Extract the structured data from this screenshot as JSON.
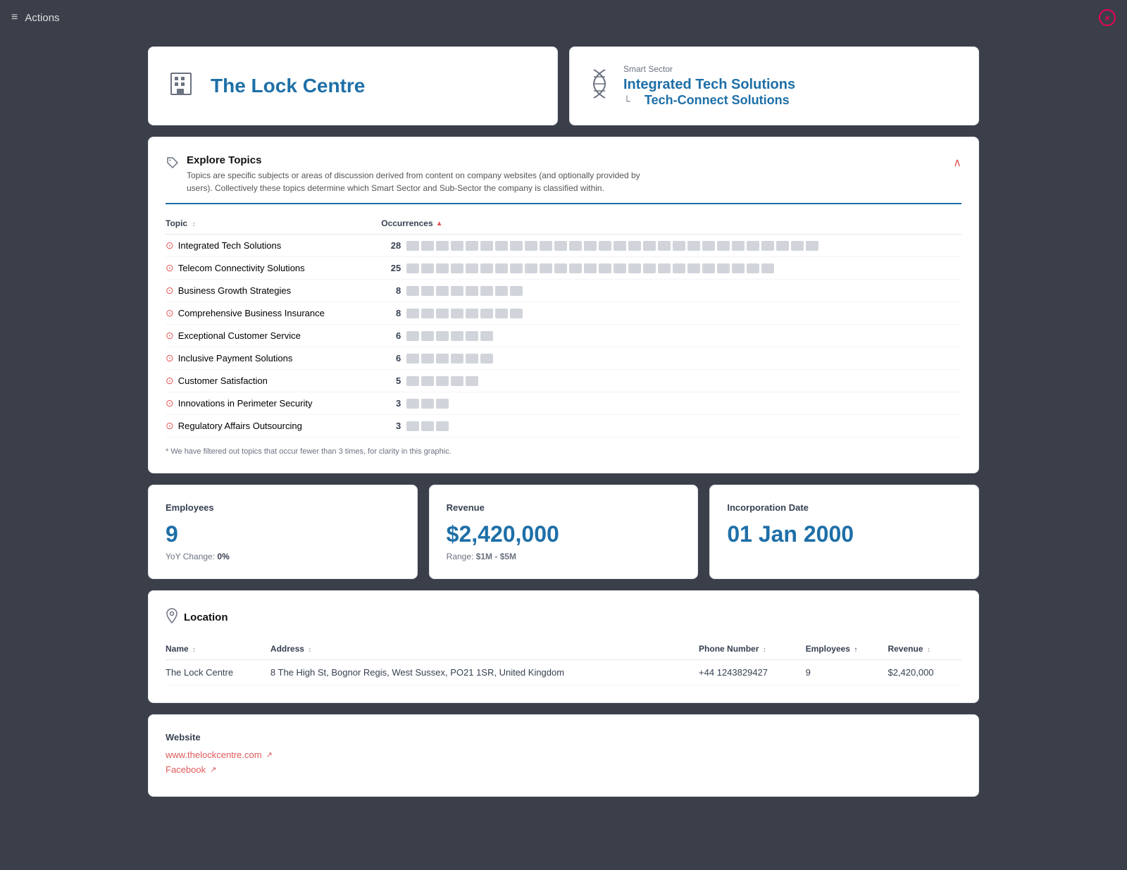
{
  "topBar": {
    "actionsLabel": "Actions",
    "closeBtn": "×"
  },
  "companyCard": {
    "name": "The Lock Centre",
    "buildingIconUnicode": "🏢"
  },
  "sectorCard": {
    "smartSectorLabel": "Smart Sector",
    "primarySector": "Integrated Tech Solutions",
    "secondarySector": "Tech-Connect Solutions",
    "dnaIconUnicode": "⌥"
  },
  "topicsSection": {
    "tagIcon": "🏷",
    "title": "Explore Topics",
    "description": "Topics are specific subjects or areas of discussion derived from content on company websites (and optionally provided by users). Collectively these topics determine which Smart Sector and Sub-Sector the company is classified within.",
    "colTopic": "Topic",
    "colOccurrences": "Occurrences",
    "collapseIcon": "∧",
    "footerNote": "* We have filtered out topics that occur fewer than 3 times, for clarity in this graphic.",
    "topics": [
      {
        "name": "Integrated Tech Solutions",
        "count": 28,
        "bars": 28
      },
      {
        "name": "Telecom Connectivity Solutions",
        "count": 25,
        "bars": 25
      },
      {
        "name": "Business Growth Strategies",
        "count": 8,
        "bars": 8
      },
      {
        "name": "Comprehensive Business Insurance",
        "count": 8,
        "bars": 8
      },
      {
        "name": "Exceptional Customer Service",
        "count": 6,
        "bars": 6
      },
      {
        "name": "Inclusive Payment Solutions",
        "count": 6,
        "bars": 6
      },
      {
        "name": "Customer Satisfaction",
        "count": 5,
        "bars": 5
      },
      {
        "name": "Innovations in Perimeter Security",
        "count": 3,
        "bars": 3
      },
      {
        "name": "Regulatory Affairs Outsourcing",
        "count": 3,
        "bars": 3
      }
    ]
  },
  "stats": {
    "employees": {
      "label": "Employees",
      "value": "9",
      "subLabel": "YoY Change:",
      "subValue": "0%"
    },
    "revenue": {
      "label": "Revenue",
      "value": "$2,420,000",
      "rangeLabel": "Range:",
      "rangeValue": "$1M - $5M"
    },
    "incorporation": {
      "label": "Incorporation Date",
      "value": "01 Jan 2000"
    }
  },
  "location": {
    "pinIcon": "📍",
    "title": "Location",
    "columns": [
      "Name",
      "Address",
      "Phone Number",
      "Employees",
      "Revenue"
    ],
    "rows": [
      {
        "name": "The Lock Centre",
        "address": "8 The High St, Bognor Regis, West Sussex, PO21 1SR, United Kingdom",
        "phone": "+44 1243829427",
        "employees": "9",
        "revenue": "$2,420,000"
      }
    ]
  },
  "website": {
    "title": "Website",
    "links": [
      {
        "label": "www.thelockcentre.com",
        "icon": "↗"
      },
      {
        "label": "Facebook",
        "icon": "↗"
      }
    ]
  }
}
